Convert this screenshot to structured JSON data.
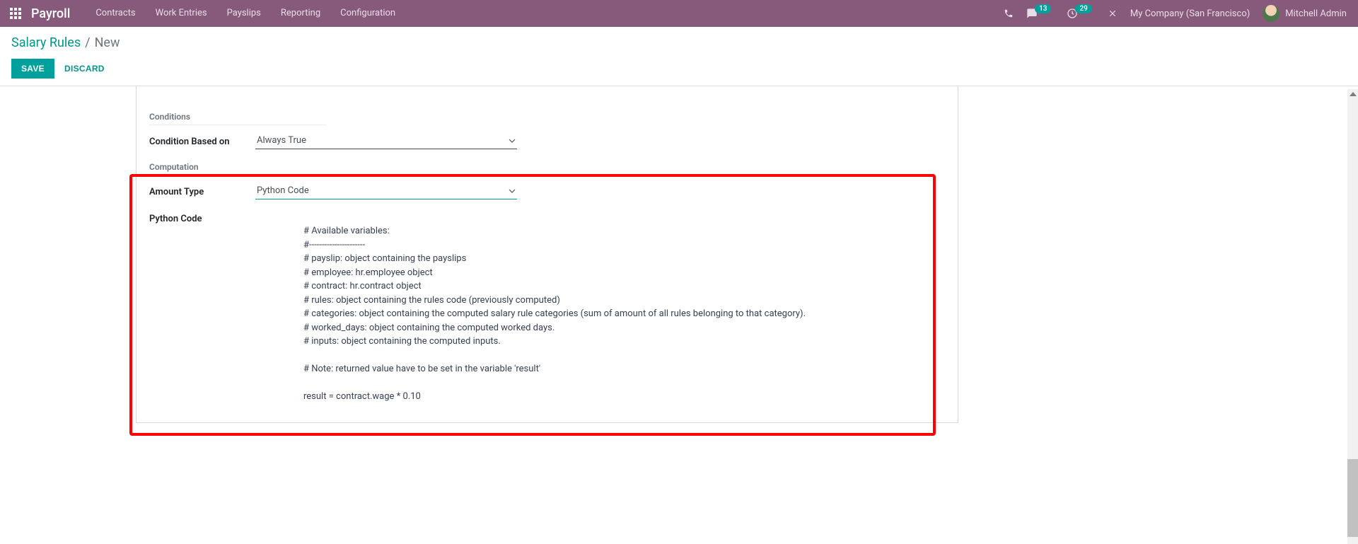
{
  "nav": {
    "app_title": "Payroll",
    "menu": [
      "Contracts",
      "Work Entries",
      "Payslips",
      "Reporting",
      "Configuration"
    ],
    "messages_badge": "13",
    "activities_badge": "29",
    "company": "My Company (San Francisco)",
    "user": "Mitchell Admin"
  },
  "controlbar": {
    "breadcrumb_root": "Salary Rules",
    "breadcrumb_sep": "/",
    "breadcrumb_current": "New",
    "save": "SAVE",
    "discard": "DISCARD"
  },
  "form": {
    "section_conditions": "Conditions",
    "condition_based_on_label": "Condition Based on",
    "condition_based_on_value": "Always True",
    "section_computation": "Computation",
    "amount_type_label": "Amount Type",
    "amount_type_value": "Python Code",
    "python_code_label": "Python Code",
    "python_code_value": "# Available variables:\n#----------------------\n# payslip: object containing the payslips\n# employee: hr.employee object\n# contract: hr.contract object\n# rules: object containing the rules code (previously computed)\n# categories: object containing the computed salary rule categories (sum of amount of all rules belonging to that category).\n# worked_days: object containing the computed worked days.\n# inputs: object containing the computed inputs.\n\n# Note: returned value have to be set in the variable 'result'\n\nresult = contract.wage * 0.10"
  }
}
